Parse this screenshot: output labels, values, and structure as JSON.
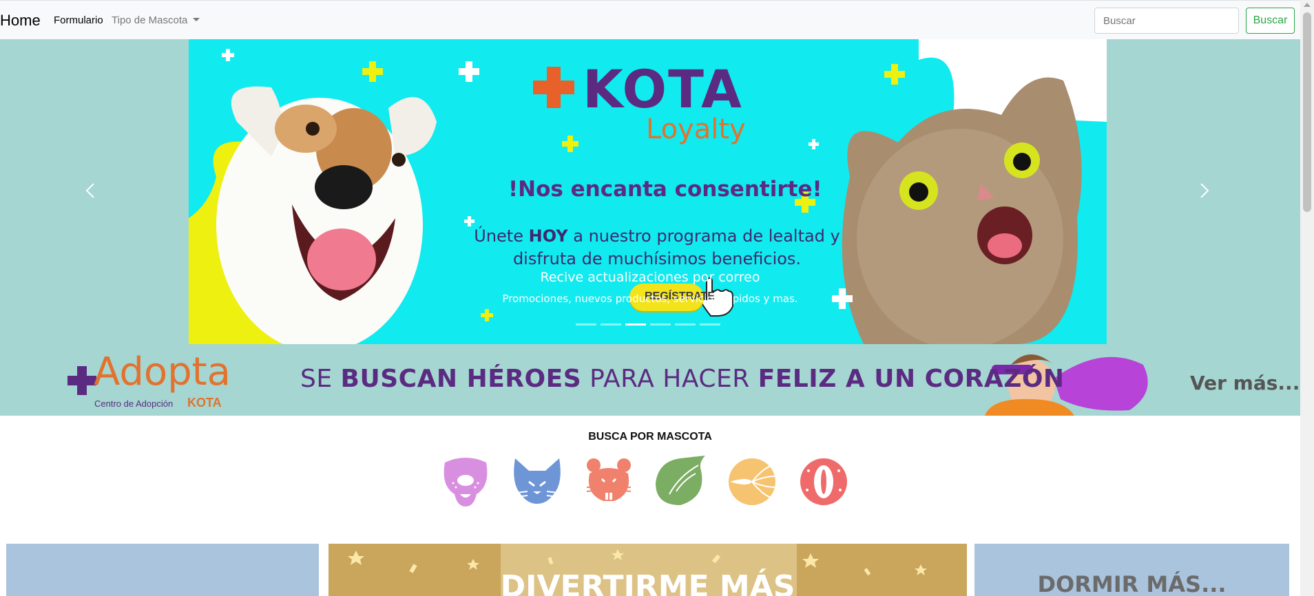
{
  "navbar": {
    "brand": "Home",
    "links": [
      {
        "label": "Formulario"
      },
      {
        "label": "Tipo de Mascota"
      }
    ],
    "search": {
      "placeholder": "Buscar",
      "value": ""
    },
    "search_button": "Buscar",
    "accent_color": "#28a745"
  },
  "carousel": {
    "slide": {
      "logo_text": "KOTA",
      "logo_subtitle": "Loyalty",
      "heading": "!Nos encanta consentirte!",
      "body_pre": "Únete ",
      "body_bold": "HOY",
      "body_post": " a nuestro programa de lealtad y disfruta de muchísimos beneficios.",
      "button_label": "REGÍSTRATE",
      "background_color": "#11eaef"
    },
    "caption": {
      "title": "Recive actualizaciones por correo",
      "text": "Promociones, nuevos productos, servicios rapidos y mas."
    },
    "indicator_count": 6,
    "active_indicator": 3,
    "prev_icon": "chevron-left-icon",
    "next_icon": "chevron-right-icon"
  },
  "adopta_banner": {
    "title": "Adopta",
    "subtitle": "Centro de Adopción",
    "subtitle_brand": "KOTA",
    "slogan": {
      "part1": "SE ",
      "part2_bold": "BUSCAN HÉROES",
      "part3": " PARA HACER ",
      "part4_bold": "FELIZ A UN CORAZÓN"
    },
    "link": "Ver más..."
  },
  "busca_section": {
    "title": "BUSCA POR MASCOTA",
    "pets": [
      {
        "icon": "dog-icon",
        "color": "#d98fe0"
      },
      {
        "icon": "cat-icon",
        "color": "#6e95d6"
      },
      {
        "icon": "rodent-icon",
        "color": "#f0826d"
      },
      {
        "icon": "bird-icon",
        "color": "#7bad62"
      },
      {
        "icon": "fish-icon",
        "color": "#f6c470"
      },
      {
        "icon": "reptile-icon",
        "color": "#ef6b6b"
      }
    ]
  },
  "tiles": {
    "middle": "DIVERTIRME MÁS",
    "right": "DORMIR MÁS..."
  }
}
